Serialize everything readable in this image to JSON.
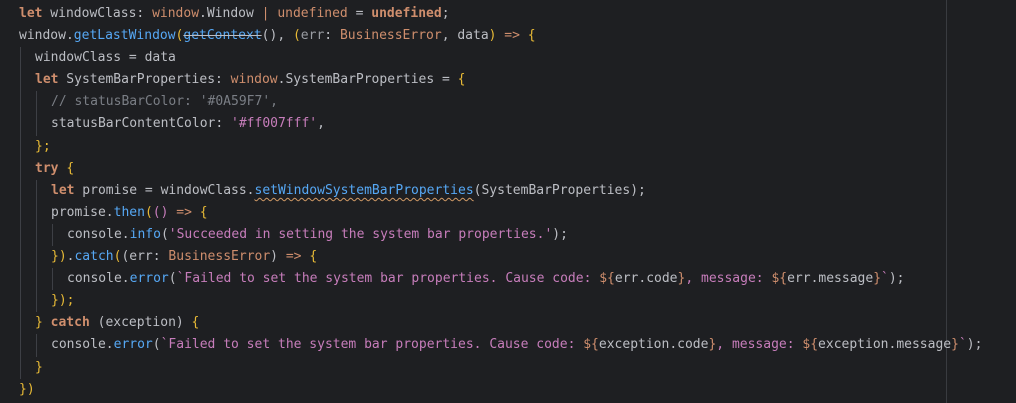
{
  "editor": {
    "language": "ArkTS",
    "colors": {
      "background": "#1e1f22",
      "keyword": "#cf8e6d",
      "function": "#56a8f5",
      "string": "#6aab73",
      "type": "#c77dbb",
      "comment": "#7a7e85",
      "text": "#bcbec4"
    },
    "lines": [
      {
        "tokens": [
          {
            "t": "let",
            "c": "kw bold"
          },
          {
            "t": " windowClass: ",
            "c": "var"
          },
          {
            "t": "window",
            "c": "kw"
          },
          {
            "t": ".Window ",
            "c": "var"
          },
          {
            "t": "|",
            "c": "kw"
          },
          {
            "t": " ",
            "c": "var"
          },
          {
            "t": "undefined",
            "c": "kw"
          },
          {
            "t": " = ",
            "c": "var"
          },
          {
            "t": "undefined",
            "c": "kw bold"
          },
          {
            "t": ";",
            "c": "punc"
          }
        ]
      },
      {
        "tokens": [
          {
            "t": "window",
            "c": "var"
          },
          {
            "t": ".",
            "c": "punc"
          },
          {
            "t": "getLastWindow",
            "c": "fn"
          },
          {
            "t": "(",
            "c": "bracket"
          },
          {
            "t": "getContext",
            "c": "fn strike"
          },
          {
            "t": "()",
            "c": "punc"
          },
          {
            "t": ", ",
            "c": "punc"
          },
          {
            "t": "(",
            "c": "bracket"
          },
          {
            "t": "err",
            "c": "param"
          },
          {
            "t": ": ",
            "c": "punc"
          },
          {
            "t": "BusinessError",
            "c": "kw"
          },
          {
            "t": ", ",
            "c": "punc"
          },
          {
            "t": "data",
            "c": "var"
          },
          {
            "t": ")",
            "c": "bracket"
          },
          {
            "t": " => ",
            "c": "kw"
          },
          {
            "t": "{",
            "c": "bracket"
          }
        ]
      },
      {
        "indent": 1,
        "tokens": [
          {
            "t": "windowClass = data",
            "c": "var"
          }
        ]
      },
      {
        "indent": 1,
        "tokens": [
          {
            "t": "let",
            "c": "kw bold"
          },
          {
            "t": " SystemBarProperties: ",
            "c": "var"
          },
          {
            "t": "window",
            "c": "kw"
          },
          {
            "t": ".SystemBarProperties = ",
            "c": "var"
          },
          {
            "t": "{",
            "c": "bracket"
          }
        ]
      },
      {
        "indent": 2,
        "tokens": [
          {
            "t": "// statusBarColor: '#0A59F7',",
            "c": "cmt"
          }
        ]
      },
      {
        "indent": 2,
        "tokens": [
          {
            "t": "statusBarContentColor: ",
            "c": "var"
          },
          {
            "t": "'#ff007fff'",
            "c": "hex"
          },
          {
            "t": ",",
            "c": "punc"
          }
        ]
      },
      {
        "indent": 1,
        "tokens": [
          {
            "t": "};",
            "c": "bracket"
          }
        ]
      },
      {
        "indent": 1,
        "tokens": [
          {
            "t": "try",
            "c": "kw bold"
          },
          {
            "t": " ",
            "c": "var"
          },
          {
            "t": "{",
            "c": "bracket"
          }
        ]
      },
      {
        "indent": 2,
        "tokens": [
          {
            "t": "let",
            "c": "kw bold"
          },
          {
            "t": " promise = windowClass.",
            "c": "var"
          },
          {
            "t": "setWindowSystemBarProperties",
            "c": "fn warn"
          },
          {
            "t": "(SystemBarProperties);",
            "c": "var"
          }
        ]
      },
      {
        "indent": 2,
        "tokens": [
          {
            "t": "promise.",
            "c": "var"
          },
          {
            "t": "then",
            "c": "fn"
          },
          {
            "t": "(",
            "c": "bracket"
          },
          {
            "t": "() ",
            "c": "type"
          },
          {
            "t": "=> ",
            "c": "kw"
          },
          {
            "t": "{",
            "c": "bracket"
          }
        ]
      },
      {
        "indent": 3,
        "tokens": [
          {
            "t": "console.",
            "c": "var"
          },
          {
            "t": "info",
            "c": "fn"
          },
          {
            "t": "(",
            "c": "punc"
          },
          {
            "t": "'Succeeded in setting the system bar properties.'",
            "c": "tpl"
          },
          {
            "t": ");",
            "c": "punc"
          }
        ]
      },
      {
        "indent": 2,
        "tokens": [
          {
            "t": "})",
            "c": "bracket"
          },
          {
            "t": ".",
            "c": "punc"
          },
          {
            "t": "catch",
            "c": "fn"
          },
          {
            "t": "(",
            "c": "bracket"
          },
          {
            "t": "(err: ",
            "c": "var"
          },
          {
            "t": "BusinessError",
            "c": "kw"
          },
          {
            "t": ") ",
            "c": "var"
          },
          {
            "t": "=> ",
            "c": "kw"
          },
          {
            "t": "{",
            "c": "bracket"
          }
        ]
      },
      {
        "indent": 3,
        "tokens": [
          {
            "t": "console.",
            "c": "var"
          },
          {
            "t": "error",
            "c": "fn"
          },
          {
            "t": "(",
            "c": "punc"
          },
          {
            "t": "`Failed to set the system bar properties. Cause code: ",
            "c": "tpl"
          },
          {
            "t": "${",
            "c": "kw"
          },
          {
            "t": "err.code",
            "c": "var"
          },
          {
            "t": "}",
            "c": "kw"
          },
          {
            "t": ", message: ",
            "c": "tpl"
          },
          {
            "t": "${",
            "c": "kw"
          },
          {
            "t": "err.message",
            "c": "var"
          },
          {
            "t": "}",
            "c": "kw"
          },
          {
            "t": "`",
            "c": "tpl"
          },
          {
            "t": ");",
            "c": "punc"
          }
        ]
      },
      {
        "indent": 2,
        "tokens": [
          {
            "t": "});",
            "c": "bracket"
          }
        ]
      },
      {
        "indent": 1,
        "tokens": [
          {
            "t": "}",
            "c": "bracket"
          },
          {
            "t": " ",
            "c": "var"
          },
          {
            "t": "catch",
            "c": "kw bold"
          },
          {
            "t": " (exception) ",
            "c": "var"
          },
          {
            "t": "{",
            "c": "bracket"
          }
        ]
      },
      {
        "indent": 2,
        "tokens": [
          {
            "t": "console.",
            "c": "var"
          },
          {
            "t": "error",
            "c": "fn"
          },
          {
            "t": "(",
            "c": "punc"
          },
          {
            "t": "`Failed to set the system bar properties. Cause code: ",
            "c": "tpl"
          },
          {
            "t": "${",
            "c": "kw"
          },
          {
            "t": "exception.code",
            "c": "var"
          },
          {
            "t": "}",
            "c": "kw"
          },
          {
            "t": ", message: ",
            "c": "tpl"
          },
          {
            "t": "${",
            "c": "kw"
          },
          {
            "t": "exception.message",
            "c": "var"
          },
          {
            "t": "}",
            "c": "kw"
          },
          {
            "t": "`",
            "c": "tpl"
          },
          {
            "t": ");",
            "c": "punc"
          }
        ]
      },
      {
        "indent": 1,
        "tokens": [
          {
            "t": "}",
            "c": "bracket"
          }
        ]
      },
      {
        "tokens": [
          {
            "t": "})",
            "c": "bracket"
          }
        ]
      }
    ]
  }
}
